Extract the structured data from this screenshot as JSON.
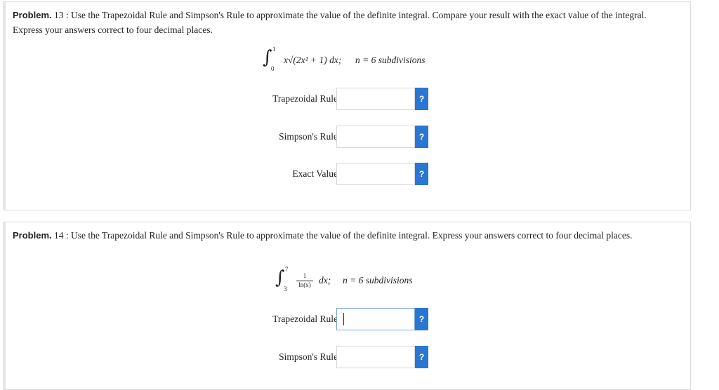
{
  "problem13": {
    "label": "Problem.",
    "number": "13 :",
    "statement": "Use the Trapezoidal Rule and Simpson's Rule to approximate the value of the definite integral. Compare your result with the exact value of the integral. Express your answers correct to four decimal places.",
    "integral": {
      "lower": "0",
      "upper": "1",
      "integrand": "x√(2x² + 1) dx;",
      "n_text": "n = 6 subdivisions"
    },
    "fields": [
      {
        "label": "Trapezoidal Rule",
        "value": "",
        "help": "?"
      },
      {
        "label": "Simpson's Rule",
        "value": "",
        "help": "?"
      },
      {
        "label": "Exact Value",
        "value": "",
        "help": "?"
      }
    ]
  },
  "problem14": {
    "label": "Problem.",
    "number": "14 :",
    "statement": "Use the Trapezoidal Rule and Simpson's Rule to approximate the value of the definite integral. Express your answers correct to four decimal places.",
    "integral": {
      "lower": "3",
      "upper": "7",
      "numerator": "1",
      "denominator": "ln(x)",
      "dx": "dx;",
      "n_text": "n = 6 subdivisions"
    },
    "fields": [
      {
        "label": "Trapezoidal Rule",
        "value": "",
        "help": "?"
      },
      {
        "label": "Simpson's Rule",
        "value": "",
        "help": "?"
      }
    ]
  }
}
